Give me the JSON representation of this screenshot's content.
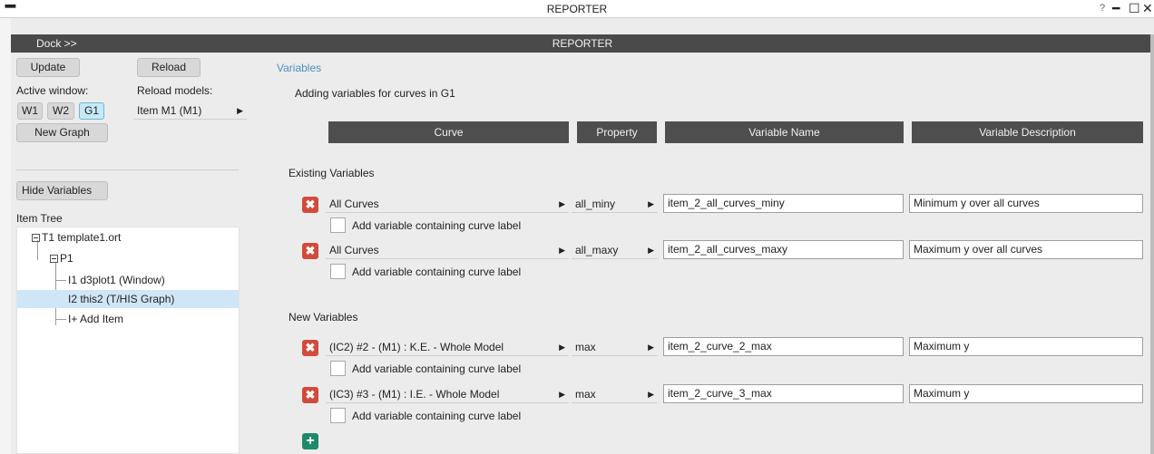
{
  "window": {
    "title": "REPORTER",
    "help_glyph": "?",
    "minimize_glyph": "━",
    "maximize_glyph": "☐",
    "close_glyph": "✕",
    "menu_glyph": "━"
  },
  "dockbar": {
    "dock_label": "Dock >>",
    "title": "REPORTER"
  },
  "left": {
    "update_label": "Update",
    "reload_label": "Reload",
    "active_window_label": "Active window:",
    "reload_models_label": "Reload models:",
    "windows": [
      "W1",
      "W2",
      "G1"
    ],
    "active_window": "G1",
    "reload_model_value": "Item M1 (M1)",
    "new_graph_label": "New Graph",
    "hide_variables_label": "Hide Variables",
    "item_tree_label": "Item Tree",
    "tree": {
      "template": "T1 template1.ort",
      "page": "P1",
      "items": [
        "I1 d3plot1 (Window)",
        "I2 this2 (T/HIS Graph)",
        "I+ Add Item"
      ],
      "selected_index": 1
    }
  },
  "main": {
    "variables_link": "Variables",
    "subtitle": "Adding variables for curves in G1",
    "columns": [
      "Curve",
      "Property",
      "Variable Name",
      "Variable Description"
    ],
    "existing_label": "Existing Variables",
    "new_label": "New Variables",
    "checkbox_label": "Add variable containing curve label",
    "delete_glyph": "✖",
    "add_glyph": "+",
    "existing": [
      {
        "curve": "All Curves",
        "property": "all_miny",
        "name": "item_2_all_curves_miny",
        "description": "Minimum y over all curves"
      },
      {
        "curve": "All Curves",
        "property": "all_maxy",
        "name": "item_2_all_curves_maxy",
        "description": "Maximum y over all curves"
      }
    ],
    "new": [
      {
        "curve": "(IC2) #2 - (M1) : K.E. - Whole Model",
        "property": "max",
        "name": "item_2_curve_2_max",
        "description": "Maximum y"
      },
      {
        "curve": "(IC3) #3 - (M1) : I.E. - Whole Model",
        "property": "max",
        "name": "item_2_curve_3_max",
        "description": "Maximum y"
      }
    ]
  },
  "colors": {
    "dockbar": "#4a4a4a",
    "header": "#4e4e4e",
    "delete": "#d24b3a",
    "add": "#1f8a6b",
    "link": "#4a90c4",
    "selection": "#cfe6f7",
    "active_window_button": "#c7e9f6"
  }
}
